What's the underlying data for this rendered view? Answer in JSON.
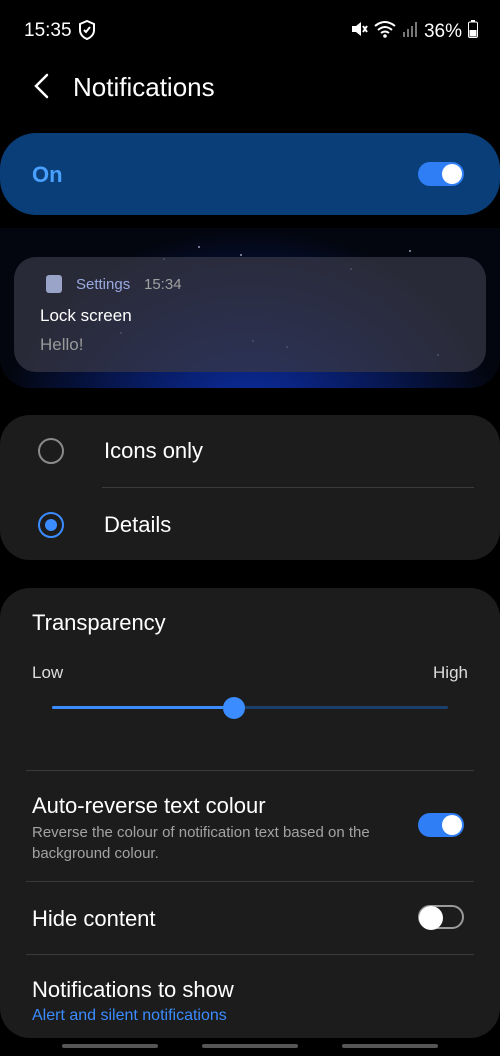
{
  "status_bar": {
    "time": "15:35",
    "battery": "36%"
  },
  "header": {
    "title": "Notifications"
  },
  "master": {
    "label": "On",
    "enabled": true
  },
  "preview": {
    "app": "Settings",
    "time": "15:34",
    "title": "Lock screen",
    "body": "Hello!"
  },
  "style": {
    "options": [
      {
        "label": "Icons only",
        "selected": false
      },
      {
        "label": "Details",
        "selected": true
      }
    ]
  },
  "transparency": {
    "title": "Transparency",
    "low": "Low",
    "high": "High",
    "level": 0.46
  },
  "auto_reverse": {
    "title": "Auto-reverse text colour",
    "desc": "Reverse the colour of notification text based on the background colour.",
    "enabled": true
  },
  "hide_content": {
    "title": "Hide content",
    "enabled": false
  },
  "notifications_to_show": {
    "title": "Notifications to show",
    "value": "Alert and silent notifications"
  }
}
